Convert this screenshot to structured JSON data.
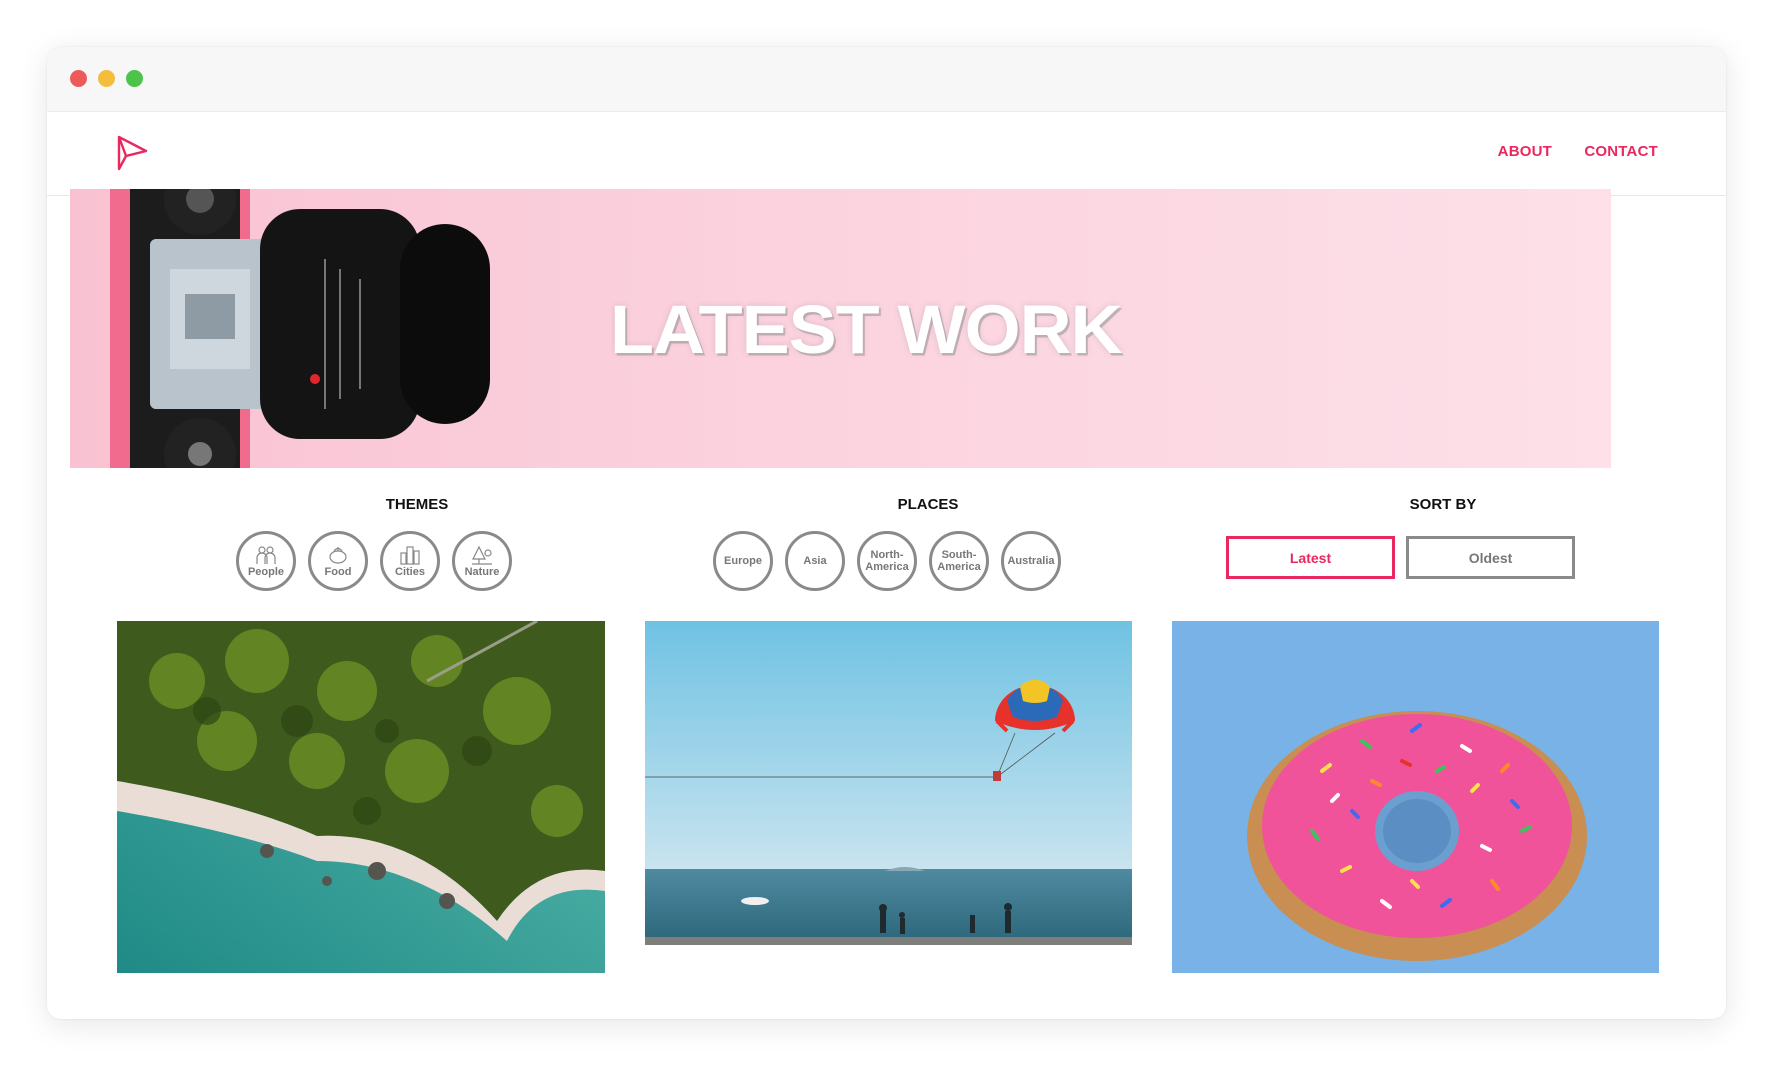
{
  "window": {
    "controls": [
      "close",
      "minimize",
      "maximize"
    ]
  },
  "nav": {
    "logo_icon": "paper-plane-logo-icon",
    "links": [
      {
        "label": "ABOUT"
      },
      {
        "label": "CONTACT"
      }
    ]
  },
  "hero": {
    "title": "LATEST WORK"
  },
  "filters": {
    "themes": {
      "heading": "THEMES",
      "items": [
        {
          "label": "People",
          "icon": "people-icon"
        },
        {
          "label": "Food",
          "icon": "food-icon"
        },
        {
          "label": "Cities",
          "icon": "city-icon"
        },
        {
          "label": "Nature",
          "icon": "nature-icon"
        }
      ]
    },
    "places": {
      "heading": "PLACES",
      "items": [
        {
          "label": "Europe"
        },
        {
          "label": "Asia"
        },
        {
          "label": "North-",
          "label2": "America"
        },
        {
          "label": "South-",
          "label2": "America"
        },
        {
          "label": "Australia"
        }
      ]
    },
    "sort": {
      "heading": "SORT BY",
      "options": [
        {
          "label": "Latest",
          "selected": true
        },
        {
          "label": "Oldest",
          "selected": false
        }
      ]
    }
  },
  "gallery": {
    "photos": [
      {
        "subject": "aerial-forest-beach"
      },
      {
        "subject": "parasailing-over-sea"
      },
      {
        "subject": "pink-donut"
      }
    ]
  },
  "colors": {
    "accent": "#e8285e",
    "hero_bg": "#fbd2de",
    "chip_border": "#8a8a8a"
  }
}
